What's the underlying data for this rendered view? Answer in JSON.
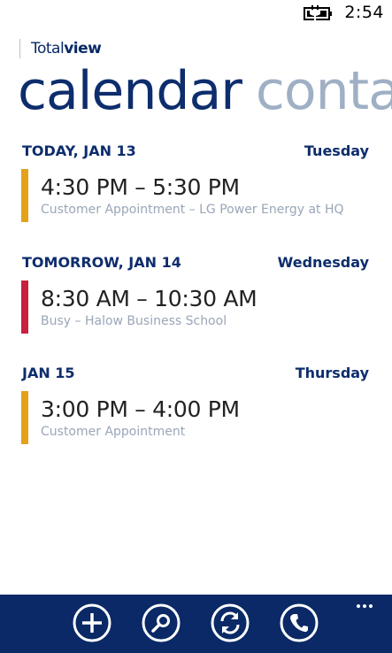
{
  "status_bar": {
    "time": "2:54",
    "icon": "battery-charging-icon"
  },
  "brand": {
    "light": "Total",
    "bold": "view"
  },
  "pivot": {
    "active": "calendar",
    "next": "conta"
  },
  "days": [
    {
      "date": "TODAY, JAN 13",
      "weekday": "Tuesday",
      "event": {
        "time": "4:30 PM – 5:30 PM",
        "description": "Customer Appointment – LG Power Energy at HQ",
        "color": "#e3a21a"
      }
    },
    {
      "date": "TOMORROW, JAN 14",
      "weekday": "Wednesday",
      "event": {
        "time": "8:30 AM – 10:30 AM",
        "description": "Busy – Halow Business School",
        "color": "#c8203f"
      }
    },
    {
      "date": "JAN 15",
      "weekday": "Thursday",
      "event": {
        "time": "3:00 PM – 4:00 PM",
        "description": "Customer Appointment",
        "color": "#e3a21a"
      }
    }
  ],
  "app_bar": {
    "background": "#0a2966",
    "buttons": [
      "add-icon",
      "search-icon",
      "sync-icon",
      "phone-icon"
    ],
    "more": "more-dots-icon"
  }
}
